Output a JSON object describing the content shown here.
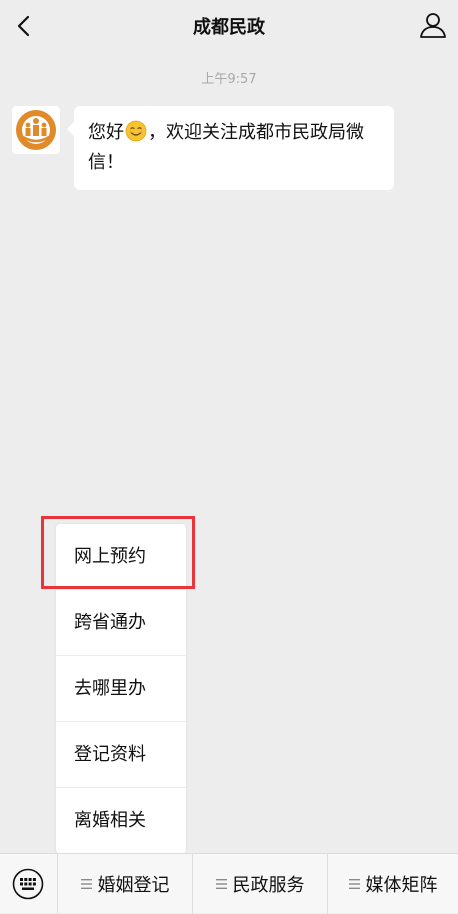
{
  "nav": {
    "title": "成都民政"
  },
  "chat": {
    "timestamp": "上午9:57",
    "message_part1": "您好",
    "message_part2": "，欢迎关注成都市民政局微信！"
  },
  "submenu": {
    "items": [
      "网上预约",
      "跨省通办",
      "去哪里办",
      "登记资料",
      "离婚相关"
    ]
  },
  "bottom_menu": {
    "items": [
      "婚姻登记",
      "民政服务",
      "媒体矩阵"
    ]
  },
  "colors": {
    "highlight": "#e8343a",
    "logo": "#e08a2a"
  },
  "icons": {
    "back": "chevron-left-icon",
    "profile": "person-icon",
    "keyboard": "keyboard-icon",
    "menu": "menu-lines-icon"
  }
}
